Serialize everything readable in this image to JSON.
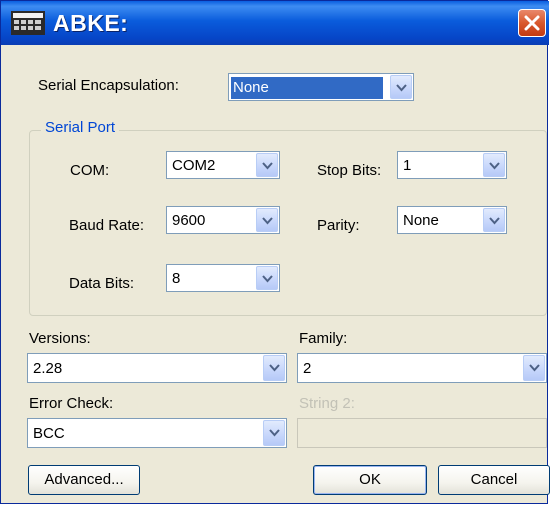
{
  "dialog": {
    "title": "ABKE:",
    "app_icon": "grid-app-icon",
    "close_icon": "close-icon"
  },
  "encapsulation": {
    "label": "Serial Encapsulation:",
    "value": "None"
  },
  "serial_port": {
    "group_title": "Serial Port",
    "com": {
      "label": "COM:",
      "value": "COM2"
    },
    "baud": {
      "label": "Baud Rate:",
      "value": "9600"
    },
    "data_bits": {
      "label": "Data Bits:",
      "value": "8"
    },
    "stop_bits": {
      "label": "Stop Bits:",
      "value": "1"
    },
    "parity": {
      "label": "Parity:",
      "value": "None"
    }
  },
  "versions": {
    "label": "Versions:",
    "value": "2.28"
  },
  "family": {
    "label": "Family:",
    "value": "2"
  },
  "error_check": {
    "label": "Error Check:",
    "value": "BCC"
  },
  "string2": {
    "label": "String 2:",
    "value": ""
  },
  "buttons": {
    "advanced": "Advanced...",
    "ok": "OK",
    "cancel": "Cancel"
  },
  "colors": {
    "title_bar": "#0a5cdc",
    "dialog_bg": "#ece9d8",
    "selection": "#316ac5",
    "close": "#d9582d",
    "group_title": "#0046d5"
  }
}
